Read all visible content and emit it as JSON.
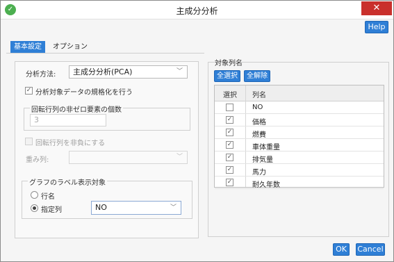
{
  "window": {
    "title": "主成分分析",
    "close_symbol": "✕",
    "app_icon": "✓"
  },
  "header": {
    "help_label": "Help"
  },
  "tabs": [
    {
      "label": "基本設定"
    },
    {
      "label": "オプション"
    }
  ],
  "settings": {
    "method_label": "分析方法:",
    "method_value": "主成分分析(PCA)",
    "normalize_label": "分析対象データの規格化を行う",
    "normalize_checked": true,
    "nonzero_group_label": "回転行列の非ゼロ要素の個数",
    "nonzero_value": "3",
    "nonnegative_label": "回転行列を非負にする",
    "weight_label": "重み列:",
    "weight_value": "",
    "graph_label_group": "グラフのラベル表示対象",
    "radio_row_label": "行名",
    "radio_column_label": "指定列",
    "column_select_value": "NO"
  },
  "target_columns": {
    "legend": "対象列名",
    "select_all_label": "全選択",
    "clear_all_label": "全解除",
    "header_select": "選択",
    "header_name": "列名",
    "check_mark": "✓",
    "rows": [
      {
        "name": "NO",
        "checked": false
      },
      {
        "name": "価格",
        "checked": true
      },
      {
        "name": "燃費",
        "checked": true
      },
      {
        "name": "車体重量",
        "checked": true
      },
      {
        "name": "排気量",
        "checked": true
      },
      {
        "name": "馬力",
        "checked": true
      },
      {
        "name": "耐久年数",
        "checked": true
      }
    ]
  },
  "footer": {
    "ok_label": "OK",
    "cancel_label": "Cancel"
  },
  "icons": {
    "chevron": "﹀"
  }
}
